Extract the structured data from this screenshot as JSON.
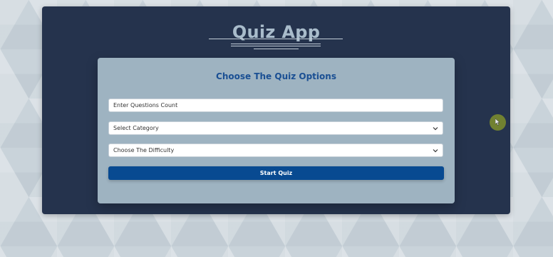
{
  "app": {
    "title": "Quiz App"
  },
  "card": {
    "title": "Choose The Quiz Options"
  },
  "form": {
    "questions_count": {
      "value": "",
      "placeholder": "Enter Questions Count"
    },
    "category": {
      "selected": "Select Category",
      "icon": "chevron-down-icon"
    },
    "difficulty": {
      "selected": "Choose The Difficulty",
      "icon": "chevron-down-icon"
    },
    "start_label": "Start Quiz"
  },
  "colors": {
    "window_bg": "#25334d",
    "card_bg": "#9eb3c1",
    "card_title": "#1a4f93",
    "button_bg": "#084a91",
    "cursor_dot": "#7a8a2e"
  }
}
